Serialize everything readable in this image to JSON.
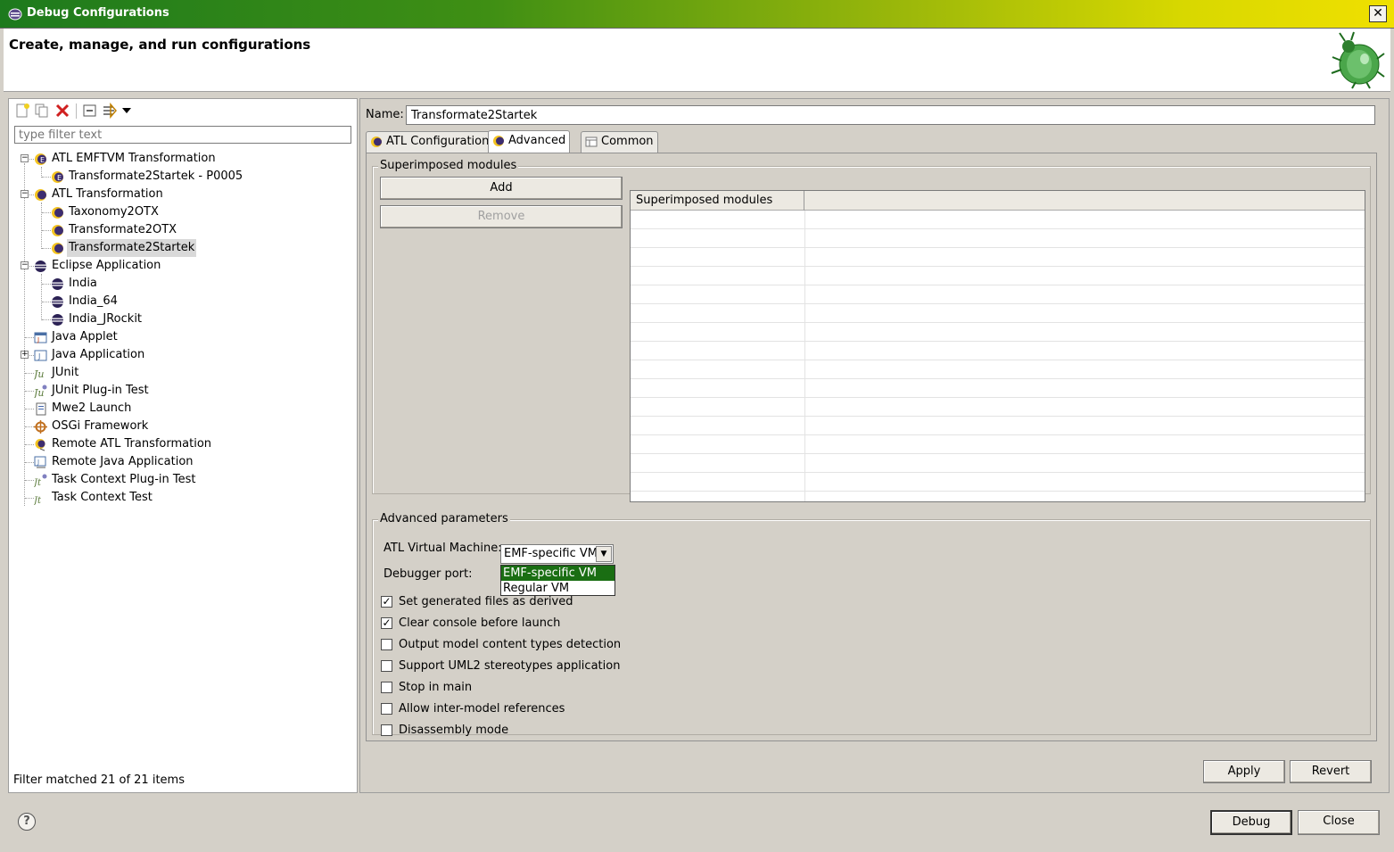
{
  "window": {
    "title": "Debug Configurations",
    "close_glyph": "✕"
  },
  "header": {
    "title": "Create, manage, and run configurations"
  },
  "left": {
    "toolbar_icons": [
      "new-config-icon",
      "duplicate-icon",
      "delete-icon",
      "collapse-all-icon",
      "filter-icon",
      "view-menu-icon"
    ],
    "filter_placeholder": "type filter text",
    "tree": [
      {
        "label": "ATL EMFTVM Transformation",
        "level": 0,
        "expanded": true,
        "icon": "atl-emftvm-icon"
      },
      {
        "label": "Transformate2Startek - P0005",
        "level": 1,
        "icon": "atl-emftvm-icon"
      },
      {
        "label": "ATL Transformation",
        "level": 0,
        "expanded": true,
        "icon": "atl-icon"
      },
      {
        "label": "Taxonomy2OTX",
        "level": 1,
        "icon": "atl-icon"
      },
      {
        "label": "Transformate2OTX",
        "level": 1,
        "icon": "atl-icon"
      },
      {
        "label": "Transformate2Startek",
        "level": 1,
        "icon": "atl-icon",
        "selected": true
      },
      {
        "label": "Eclipse Application",
        "level": 0,
        "expanded": true,
        "icon": "eclipse-icon"
      },
      {
        "label": "India",
        "level": 1,
        "icon": "eclipse-icon"
      },
      {
        "label": "India_64",
        "level": 1,
        "icon": "eclipse-icon"
      },
      {
        "label": "India_JRockit",
        "level": 1,
        "icon": "eclipse-icon"
      },
      {
        "label": "Java Applet",
        "level": 0,
        "icon": "java-applet-icon"
      },
      {
        "label": "Java Application",
        "level": 0,
        "expandable": true,
        "icon": "java-app-icon"
      },
      {
        "label": "JUnit",
        "level": 0,
        "icon": "junit-icon"
      },
      {
        "label": "JUnit Plug-in Test",
        "level": 0,
        "icon": "junit-plugin-icon"
      },
      {
        "label": "Mwe2 Launch",
        "level": 0,
        "icon": "mwe2-icon"
      },
      {
        "label": "OSGi Framework",
        "level": 0,
        "icon": "osgi-icon"
      },
      {
        "label": "Remote ATL Transformation",
        "level": 0,
        "icon": "remote-atl-icon"
      },
      {
        "label": "Remote Java Application",
        "level": 0,
        "icon": "remote-java-icon"
      },
      {
        "label": "Task Context Plug-in Test",
        "level": 0,
        "icon": "task-plugin-icon"
      },
      {
        "label": "Task Context Test",
        "level": 0,
        "icon": "task-test-icon"
      }
    ],
    "status": "Filter matched 21 of 21 items"
  },
  "right": {
    "name_label": "Name:",
    "name_value": "Transformate2Startek",
    "tabs": [
      {
        "label": "ATL Configuration",
        "icon": "atl-icon"
      },
      {
        "label": "Advanced",
        "icon": "atl-icon",
        "active": true
      },
      {
        "label": "Common",
        "icon": "common-icon"
      }
    ],
    "superimposed": {
      "group_title": "Superimposed modules",
      "add_label": "Add",
      "remove_label": "Remove",
      "column_header": "Superimposed modules",
      "row_count": 15
    },
    "advanced": {
      "group_title": "Advanced parameters",
      "vm_label": "ATL Virtual Machine:",
      "vm_value": "EMF-specific VM",
      "vm_options": [
        "EMF-specific VM",
        "Regular VM"
      ],
      "debugger_port_label": "Debugger port:",
      "checkboxes": [
        {
          "label": "Set generated files as derived",
          "checked": true
        },
        {
          "label": "Clear console before launch",
          "checked": true
        },
        {
          "label": "Output model content types detection",
          "checked": false
        },
        {
          "label": "Support UML2 stereotypes application",
          "checked": false
        },
        {
          "label": "Stop in main",
          "checked": false
        },
        {
          "label": "Allow inter-model references",
          "checked": false
        },
        {
          "label": "Disassembly mode",
          "checked": false
        }
      ]
    },
    "apply_label": "Apply",
    "revert_label": "Revert"
  },
  "footer": {
    "help_glyph": "?",
    "debug_label": "Debug",
    "close_label": "Close"
  },
  "colors": {
    "highlight": "#1a6e13",
    "titlebar_start": "#1d7a1d",
    "titlebar_end": "#f0e000"
  }
}
